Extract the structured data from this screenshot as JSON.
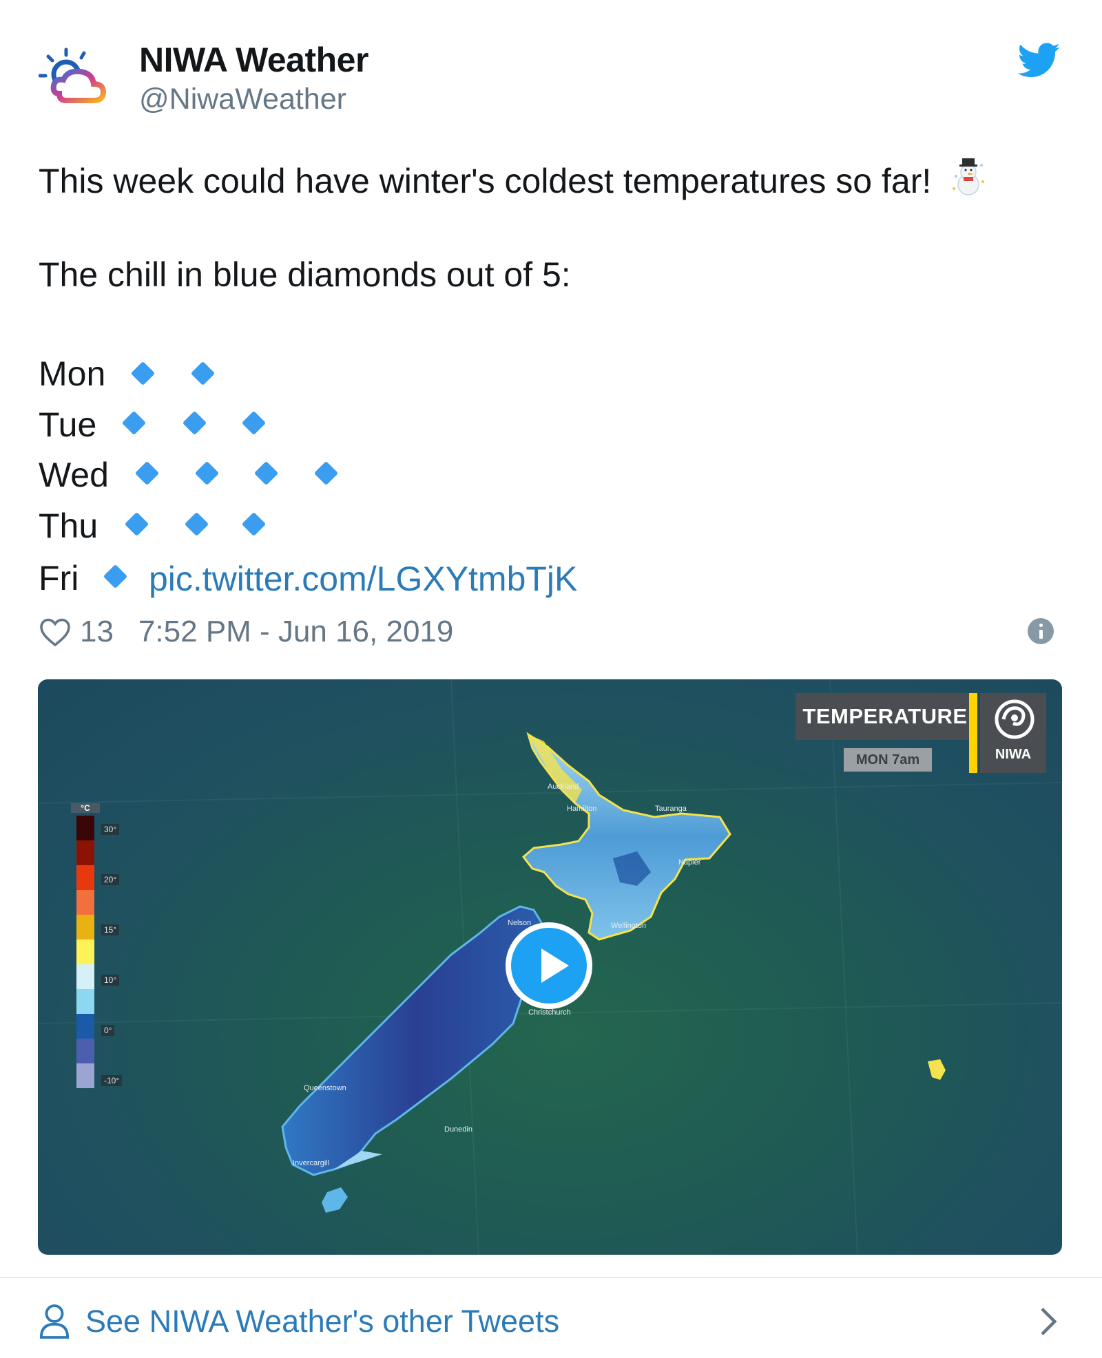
{
  "tweet": {
    "author_name": "NIWA Weather",
    "author_handle": "@NiwaWeather",
    "line1": "This week could have winter's coldest temperatures so far!",
    "line1_emoji": "snowman-icon",
    "line2": "The chill in blue diamonds out of 5:",
    "days": [
      {
        "label": "Mon",
        "diamonds": 2
      },
      {
        "label": "Tue",
        "diamonds": 3
      },
      {
        "label": "Wed",
        "diamonds": 4
      },
      {
        "label": "Thu",
        "diamonds": 3
      },
      {
        "label": "Fri",
        "diamonds": 1
      }
    ],
    "pic_link": "pic.twitter.com/LGXYtmbTjK",
    "likes": "13",
    "timestamp": "7:52 PM - Jun 16, 2019"
  },
  "media": {
    "badge_title": "TEMPERATURE",
    "badge_sub": "MON 7am",
    "logo_label": "NIWA",
    "legend_unit": "°C",
    "legend_ticks": [
      "30°",
      "20°",
      "15°",
      "10°",
      "0°",
      "-10°"
    ],
    "legend_colors": [
      "#3a0607",
      "#8c1205",
      "#e8390e",
      "#f2703d",
      "#e8b213",
      "#fff158",
      "#d5f1f7",
      "#8ed7f2",
      "#1b5aa8",
      "#4c5fae",
      "#9aa5d4"
    ],
    "cities": [
      "Auckland",
      "Hamilton",
      "Tauranga",
      "Napier",
      "Wellington",
      "Nelson",
      "Christchurch",
      "Queenstown",
      "Dunedin",
      "Invercargill"
    ]
  },
  "footer": {
    "link": "See NIWA Weather's other Tweets"
  },
  "colors": {
    "diamond": "#3a9df0",
    "link": "#2b7bb9",
    "muted": "#657786",
    "twitter_blue": "#1da1f2"
  }
}
